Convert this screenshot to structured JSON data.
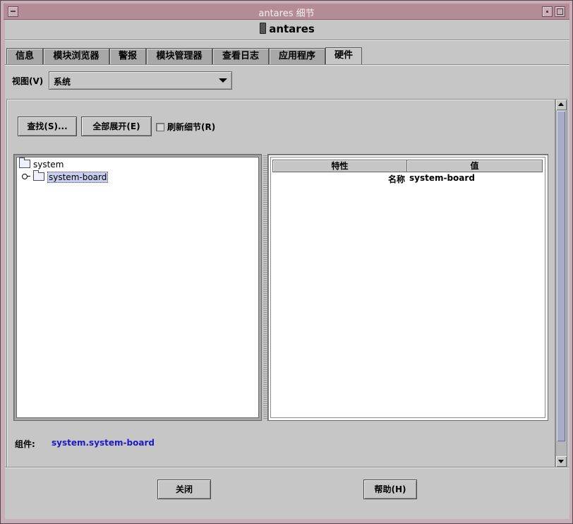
{
  "window": {
    "title": "antares 细节"
  },
  "host": {
    "name": "antares"
  },
  "tabs": [
    {
      "label": "信息",
      "active": false
    },
    {
      "label": "模块浏览器",
      "active": false
    },
    {
      "label": "警报",
      "active": false
    },
    {
      "label": "模块管理器",
      "active": false
    },
    {
      "label": "查看日志",
      "active": false
    },
    {
      "label": "应用程序",
      "active": false
    },
    {
      "label": "硬件",
      "active": true
    }
  ],
  "view": {
    "label": "视图(V)",
    "value": "系统"
  },
  "toolbar": {
    "find_label": "查找(S)...",
    "expand_label": "全部展开(E)",
    "refresh_label": "刷新细节(R)",
    "refresh_checked": false
  },
  "tree": {
    "root": "system",
    "child": "system-board"
  },
  "properties": {
    "columns": [
      "特性",
      "值"
    ],
    "rows": [
      {
        "name": "名称",
        "value": "system-board"
      }
    ]
  },
  "component": {
    "label": "组件:",
    "value": "system.system-board"
  },
  "footer": {
    "close_label": "关闭",
    "help_label": "帮助(H)"
  },
  "colors": {
    "selection": "#c8cdf0",
    "component_value": "#1a1ac8",
    "title_bar": "#b48c98"
  }
}
